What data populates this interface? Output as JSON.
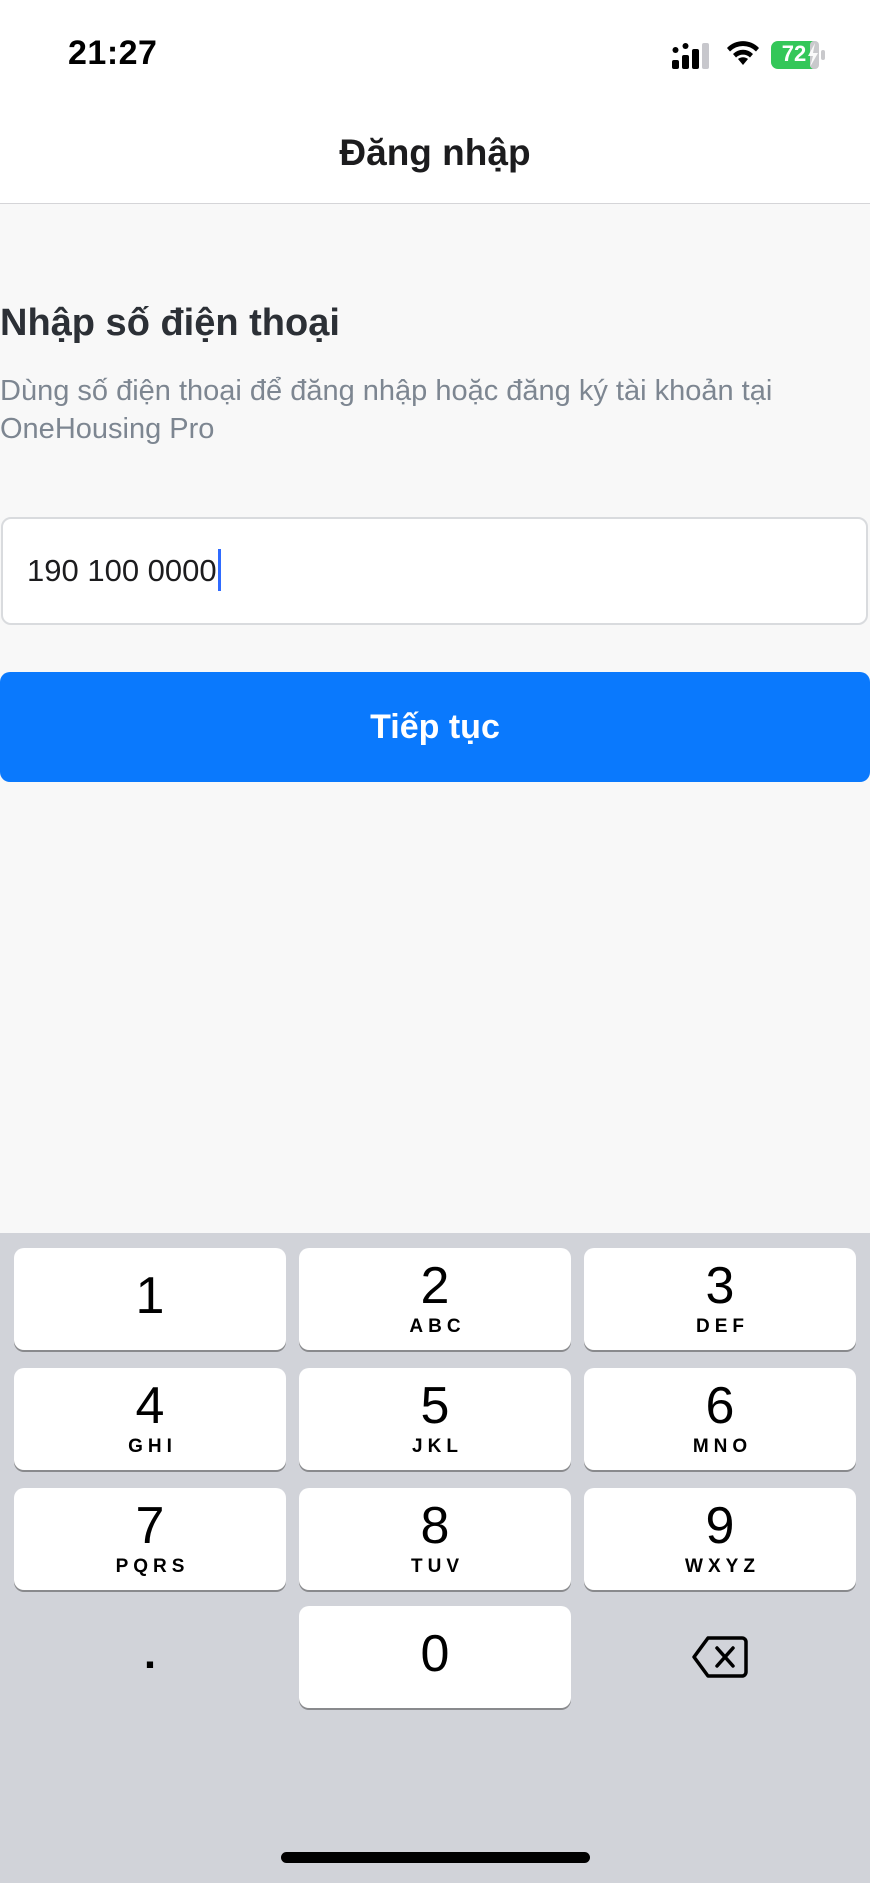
{
  "status_bar": {
    "time": "21:27",
    "battery": "72",
    "icons": [
      "signal-icon",
      "wifi-icon",
      "battery-charging-icon"
    ]
  },
  "nav": {
    "title": "Đăng nhập"
  },
  "content": {
    "heading": "Nhập số điện thoại",
    "subtitle": "Dùng số điện thoại để đăng nhập hoặc đăng ký tài khoản tại OneHousing Pro",
    "phone_field": {
      "value": "190 100 0000"
    },
    "continue_label": "Tiếp tục"
  },
  "colors": {
    "accent": "#0a79fd",
    "caret": "#2f6bff",
    "battery_green": "#34c759"
  },
  "keyboard": {
    "keys": [
      {
        "digit": "1",
        "letters": ""
      },
      {
        "digit": "2",
        "letters": "ABC"
      },
      {
        "digit": "3",
        "letters": "DEF"
      },
      {
        "digit": "4",
        "letters": "GHI"
      },
      {
        "digit": "5",
        "letters": "JKL"
      },
      {
        "digit": "6",
        "letters": "MNO"
      },
      {
        "digit": "7",
        "letters": "PQRS"
      },
      {
        "digit": "8",
        "letters": "TUV"
      },
      {
        "digit": "9",
        "letters": "WXYZ"
      },
      {
        "digit": "0",
        "letters": ""
      }
    ],
    "dot": ".",
    "backspace_icon": "delete-backward-icon"
  }
}
